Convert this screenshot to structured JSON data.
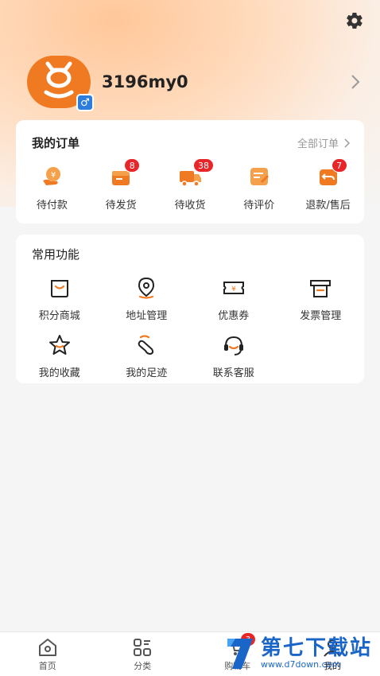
{
  "user": {
    "name": "3196my0",
    "gender_symbol": "♂"
  },
  "orders": {
    "title": "我的订单",
    "all_label": "全部订单",
    "items": [
      {
        "label": "待付款",
        "icon": "wallet-yen-icon",
        "badge": ""
      },
      {
        "label": "待发货",
        "icon": "package-icon",
        "badge": "8"
      },
      {
        "label": "待收货",
        "icon": "truck-icon",
        "badge": "38"
      },
      {
        "label": "待评价",
        "icon": "review-icon",
        "badge": ""
      },
      {
        "label": "退款/售后",
        "icon": "refund-icon",
        "badge": "7"
      }
    ]
  },
  "functions": {
    "title": "常用功能",
    "items": [
      {
        "label": "积分商城",
        "icon": "shopping-bag-icon"
      },
      {
        "label": "地址管理",
        "icon": "location-pin-icon"
      },
      {
        "label": "优惠券",
        "icon": "coupon-icon"
      },
      {
        "label": "发票管理",
        "icon": "invoice-icon"
      },
      {
        "label": "我的收藏",
        "icon": "star-icon"
      },
      {
        "label": "我的足迹",
        "icon": "footprint-icon"
      },
      {
        "label": "联系客服",
        "icon": "headset-icon"
      }
    ]
  },
  "tabbar": {
    "items": [
      {
        "label": "首页",
        "icon": "home-icon"
      },
      {
        "label": "分类",
        "icon": "category-icon"
      },
      {
        "label": "购物车",
        "icon": "cart-icon",
        "badge": "3"
      },
      {
        "label": "我的",
        "icon": "profile-icon"
      }
    ]
  },
  "watermark": {
    "title": "第七下载站",
    "url": "www.d7down.com"
  },
  "colors": {
    "accent": "#f07a22",
    "badge": "#e8262a",
    "gender": "#2e7ddc"
  }
}
